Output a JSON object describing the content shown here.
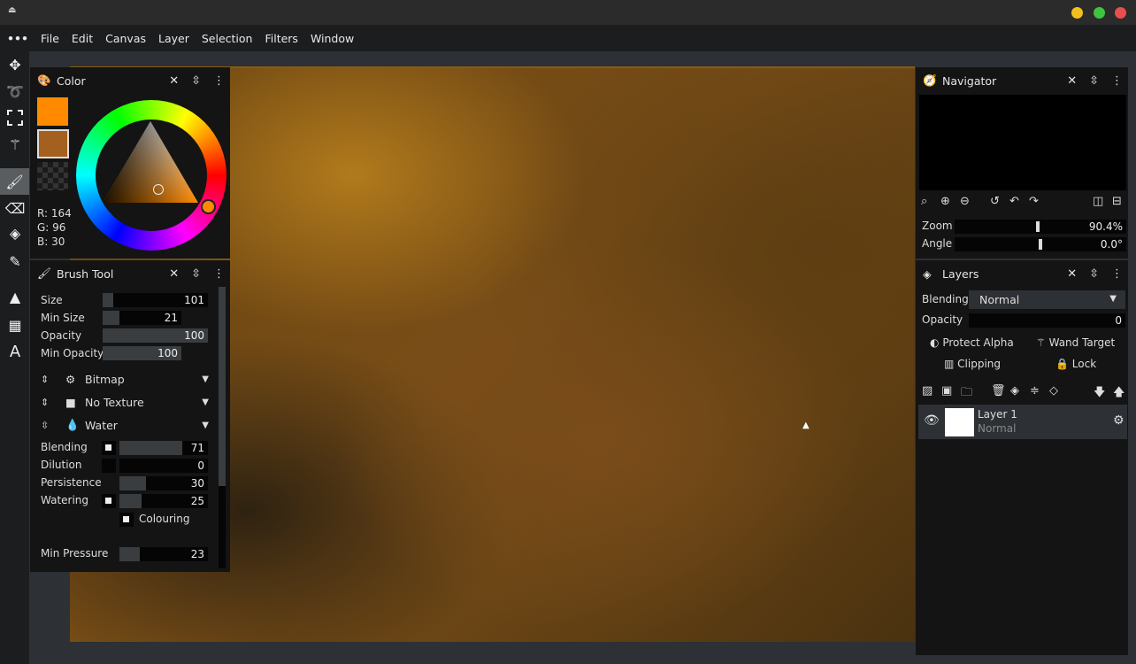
{
  "window": {
    "colors": {
      "close": "#e94e4e",
      "maximize": "#3ec43e",
      "minimize": "#f2c01e"
    }
  },
  "menu": {
    "items": [
      "File",
      "Edit",
      "Canvas",
      "Layer",
      "Selection",
      "Filters",
      "Window"
    ]
  },
  "color_panel": {
    "title": "Color",
    "primary": "#ff8a00",
    "secondary": "#a4601e",
    "r": "R: 164",
    "g": "G: 96",
    "b": "B: 30"
  },
  "brush_panel": {
    "title": "Brush Tool",
    "sliders": [
      {
        "label": "Size",
        "value": "101",
        "fraction": 0.05
      },
      {
        "label": "Min Size",
        "value": "21",
        "fraction": 0.21
      },
      {
        "label": "Opacity",
        "value": "100",
        "fraction": 1
      },
      {
        "label": "Min Opacity",
        "value": "100",
        "fraction": 1
      }
    ],
    "dropdowns": [
      {
        "label": "Bitmap"
      },
      {
        "label": "No Texture"
      },
      {
        "label": "Water"
      }
    ],
    "water": [
      {
        "label": "Blending",
        "value": "71",
        "fraction": 0.71,
        "checked": true
      },
      {
        "label": "Dilution",
        "value": "0",
        "fraction": 0,
        "checked": false
      },
      {
        "label": "Persistence",
        "value": "30",
        "fraction": 0.3,
        "checked": null
      },
      {
        "label": "Watering",
        "value": "25",
        "fraction": 0.25,
        "checked": true
      }
    ],
    "colouring": "Colouring",
    "min_pressure": {
      "label": "Min Pressure",
      "value": "23",
      "fraction": 0.23
    }
  },
  "navigator": {
    "title": "Navigator",
    "zoom_label": "Zoom",
    "zoom": "90.4%",
    "angle_label": "Angle",
    "angle": "0.0°"
  },
  "layers": {
    "title": "Layers",
    "blending_label": "Blending",
    "blending": "Normal",
    "opacity_label": "Opacity",
    "opacity": "0",
    "protect_alpha": "Protect Alpha",
    "wand_target": "Wand Target",
    "clipping": "Clipping",
    "lock": "Lock",
    "items": [
      {
        "name": "Layer 1",
        "mode": "Normal"
      }
    ]
  }
}
